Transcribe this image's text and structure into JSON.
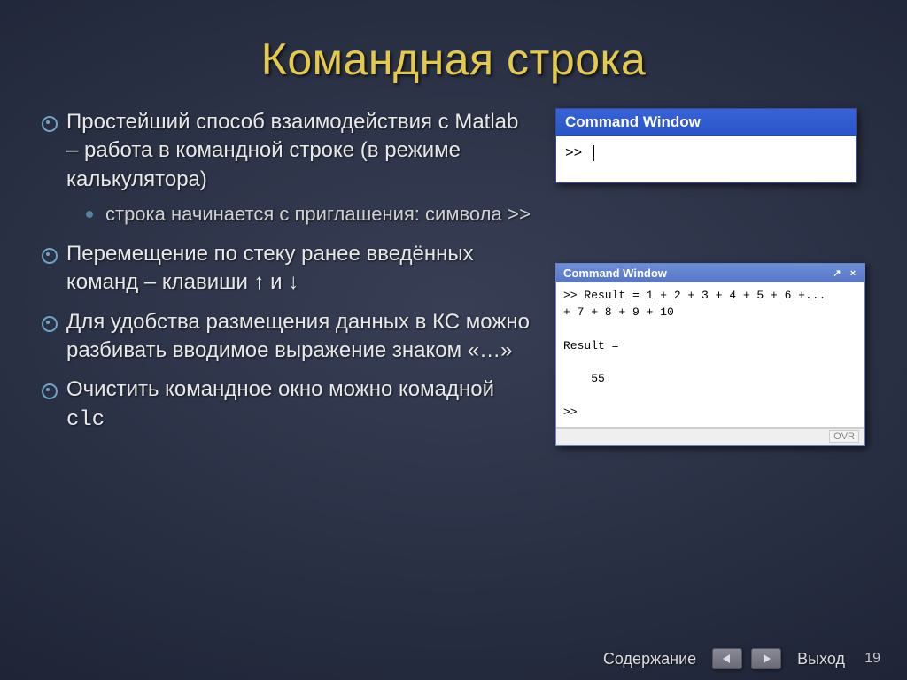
{
  "title": "Командная строка",
  "bullets": [
    {
      "text": "Простейший способ взаимодействия с Matlab – работа в командной строке (в режиме калькулятора)",
      "sub": [
        {
          "text": "строка начинается с приглашения: символа ",
          "tail_mono": ">>"
        }
      ]
    },
    {
      "text": "Перемещение по стеку ранее введённых команд – клавиши ↑ и ↓"
    },
    {
      "text": "Для удобства размещения данных в КС можно разбивать вводимое выражение знаком «…»"
    },
    {
      "text_pre": "Очистить командное окно можно комадной ",
      "tail_mono": "clc"
    }
  ],
  "win1": {
    "title": "Command Window",
    "prompt": ">> "
  },
  "win2": {
    "title": "Command Window",
    "undock_glyph": "↗",
    "close_glyph": "×",
    "body": ">> Result = 1 + 2 + 3 + 4 + 5 + 6 +...\n+ 7 + 8 + 9 + 10\n\nResult =\n\n    55\n\n>>",
    "status": "OVR"
  },
  "footer": {
    "contents": "Содержание",
    "exit": "Выход",
    "page": "19"
  }
}
